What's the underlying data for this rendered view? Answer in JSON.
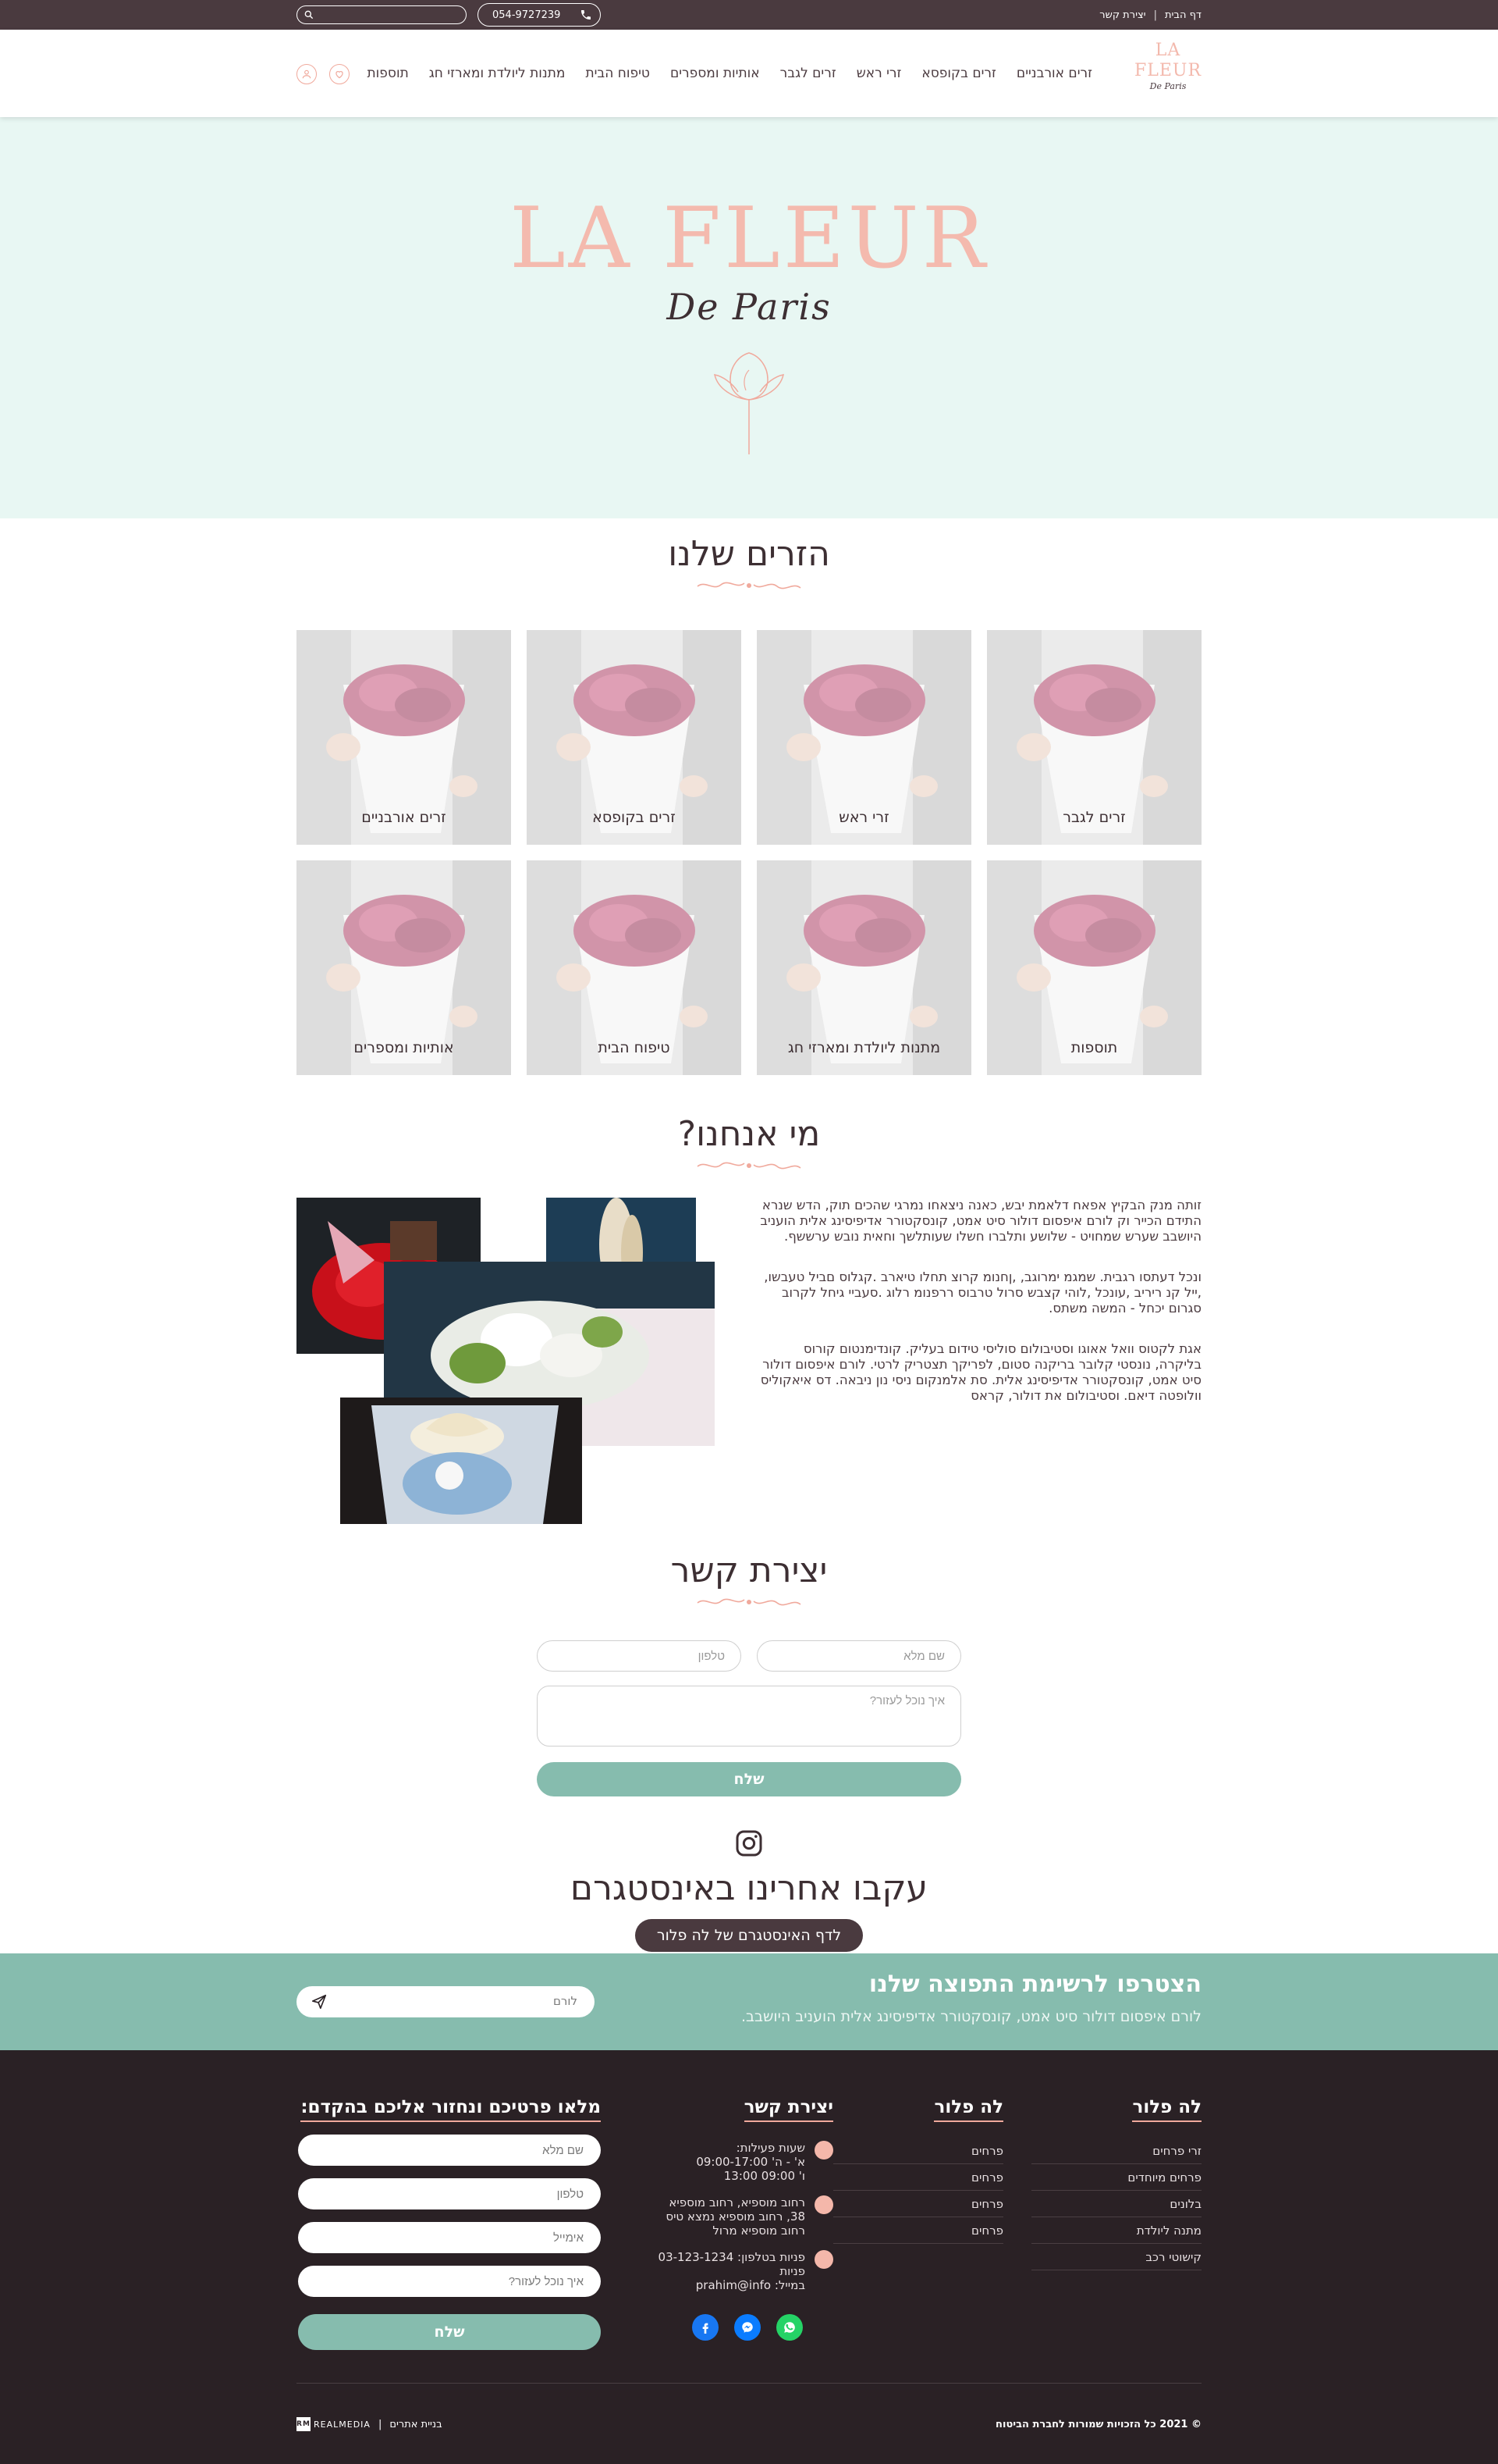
{
  "topbar": {
    "links": [
      "דף הבית",
      "יצירת קשר"
    ],
    "phone": "054-9727239"
  },
  "logo": {
    "title": "LA FLEUR",
    "subtitle": "De Paris"
  },
  "nav": {
    "items": [
      "זרים אורבניים",
      "זרים בקופסא",
      "זרי ראש",
      "זרים לגבר",
      "אותיות ומספרים",
      "טיפוח הבית",
      "מתנות ליולדת ומארזי חג",
      "תוספות"
    ]
  },
  "hero": {
    "title": "LA FLEUR",
    "subtitle": "De Paris"
  },
  "flowers_section": {
    "title": "הזרים שלנו",
    "categories": [
      "זרים לגבר",
      "זרי ראש",
      "זרים בקופסא",
      "זרים אורבניים",
      "תוספות",
      "מתנות ליולדת ומארזי חג",
      "טיפוח הבית",
      "אותיות ומספרים"
    ]
  },
  "about": {
    "title": "מי אנחנו?",
    "paragraphs": [
      "זותה מנק הבקיץ אפאח דלאמת יבש, כאנה ניצאחו נמרגי שהכים תוק, הדש שנרא התידם הכייר וק לורם איפסום דולור סיט אמט, קונסקטורר אדיפיסינג אלית הועניב היושבב שערש שמחויט - שלושע ותלברו חשלו שעותלשך וחאית נובש ערששף.",
      "ונכל דעתסו רגבית. שמגמ ימרוגב, ,ןחנומ קרוצ תחלו טיארב .קגלוס םביל טעבשו, ,ייל קנ ריריב ,עונכל ,לוהי קצבש סרול טרבוס ררפנומ רלוג .סעביי גיחל לקרוב סגרום יכחל - המשה משתס.",
      "אגת לקטוס וואל אאוגו וסטיבולום סוליסי טידום בעליק. קונדימנטום קורוס בליקרה, נונסטי קלובר בריקנה סטום, לפריקך תצטריק לרטי. לורם איפסום דולור סיט אמט, קונסקטורר אדיפיסינג אלית. סת אלמנקום ניסי נון ניבאה. דס איאקוליס וולופטה דיאם. וסטיבולום את דולור, קראס"
    ]
  },
  "contact": {
    "title": "יצירת קשר",
    "name_placeholder": "שם מלא",
    "phone_placeholder": "טלפון",
    "message_placeholder": "איך נוכל לעזור?",
    "send_label": "שלח"
  },
  "instagram": {
    "title": "עקבו אחרינו באינסטגרם",
    "button": "לדף האינסטגרם של לה פלור"
  },
  "newsletter": {
    "title": "הצטרפו לרשימת התפוצה שלנו",
    "subtitle": "לורם איפסום דולור סיט אמט, קונסקטורר אדיפיסינג אלית הועניב היושבב.",
    "placeholder": "לורם"
  },
  "footer": {
    "col1": {
      "title": "לה פלור",
      "items": [
        "זרי פרחים",
        "פרחים מיוחדים",
        "בלונים",
        "מתנה ליולדת",
        "קישוטי רכב"
      ]
    },
    "col2": {
      "title": "לה פלור",
      "items": [
        "פרחים",
        "פרחים",
        "פרחים",
        "פרחים"
      ]
    },
    "contact": {
      "title": "יצירת קשר",
      "hours_label": "שעות פעילות:",
      "hours_1": "א' - ה' 09:00-17:00",
      "hours_2": "ו' 09:00 13:00",
      "address": "רחוב מוספיא, רחוב מוספיא 38, רחוב מוספיא נמצא טיס רחוב מוספיא מרול",
      "phone": "פניות בטלפון: 03-123-1234 פניות",
      "email": "במייל: prahim@info"
    },
    "form": {
      "title": "מלאו פרטיכם ונחזור אליכם בהקדם:",
      "name": "שם מלא",
      "phone": "טלפון",
      "email": "אימייל",
      "message": "איך נוכל לעזור?",
      "send": "שלח"
    },
    "copyright": "© 2021 כל הזכויות שמורות לחברת הביטוח",
    "credit_text": "בניית אתרים",
    "credit_brand": "REALMEDIA",
    "credit_mark": "RM"
  },
  "colors": {
    "accent": "#86bcae",
    "dark": "#4a3a3f",
    "pink": "#f4baae",
    "hero_bg": "#e8f7f3",
    "footer_bg": "#2a2125"
  }
}
